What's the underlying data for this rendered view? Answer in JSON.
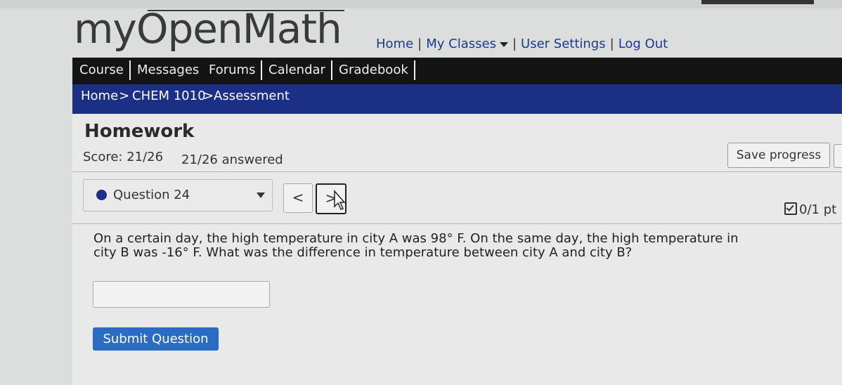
{
  "brand": {
    "logo": "myOpenMath"
  },
  "top_nav": {
    "home": "Home",
    "my_classes": "My Classes",
    "user_settings": "User Settings",
    "log_out": "Log Out"
  },
  "tabs": [
    "Course",
    "Messages",
    "Forums",
    "Calendar",
    "Gradebook"
  ],
  "breadcrumb": {
    "home": "Home",
    "course": "CHEM 1010",
    "page": "Assessment",
    "separator": ">"
  },
  "assessment": {
    "title": "Homework",
    "score": "Score: 21/26",
    "answered": "21/26 answered",
    "save_label": "Save progress"
  },
  "question": {
    "selected": "Question 24",
    "prev_label": "<",
    "next_label": ">",
    "points": "0/1 pt",
    "text": "On a certain day, the high temperature in city A was 98° F. On the same day, the high temperature in city B was -16° F. What was the difference in temperature between city A and city B?",
    "answer_value": "",
    "submit_label": "Submit Question"
  },
  "colors": {
    "nav_bar": "#141414",
    "breadcrumb_bar": "#1b2f85",
    "submit_button": "#2a6cc4",
    "link": "#1a3a8f"
  }
}
